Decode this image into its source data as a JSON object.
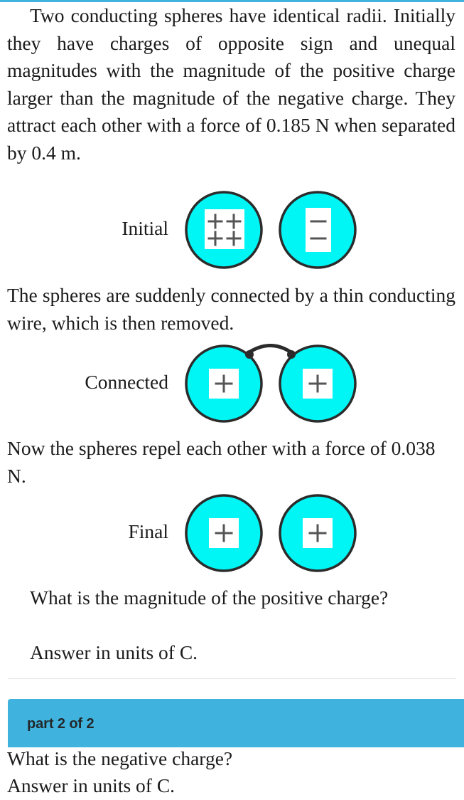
{
  "theme": {
    "sphere_fill": "#00f5f5",
    "sphere_stroke": "#2b2b2b",
    "charge_box_fill": "#ffffff",
    "charge_glyph_color": "#555555",
    "banner_color": "#3fb3de",
    "banner_text_color": "#23282b",
    "top_strip_color": "#3fb3de",
    "divider_color": "#e6e6e6",
    "body_text_color": "#1b1b1b"
  },
  "problem": {
    "intro": "Two conducting spheres have identical radii. Initially they have charges of opposite sign and unequal magnitudes with the magnitude of the positive charge larger than the magnitude of the negative charge. They attract each other with a force of 0.185 N when separated by 0.4 m.",
    "wire_text": "The spheres are suddenly connected by a thin conducting wire, which is then removed.",
    "repel_text": "Now the spheres repel each other with a force of 0.038 N.",
    "question": "What is the magnitude of the positive charge?",
    "answer_units": "Answer in units of  C.",
    "values": {
      "attractive_force": "0.185 N",
      "separation": "0.4 m",
      "repulsive_force": "0.038 N",
      "units": "C"
    }
  },
  "diagrams": [
    {
      "id": "initial",
      "label": "Initial",
      "left_sphere": {
        "charge_sign": "+",
        "charge_count": 4,
        "glyph_layout": "2x2",
        "box_shape": "square"
      },
      "right_sphere": {
        "charge_sign": "−",
        "charge_count": 2,
        "glyph_layout": "1x2",
        "box_shape": "tall"
      },
      "wire": false
    },
    {
      "id": "connected",
      "label": "Connected",
      "left_sphere": {
        "charge_sign": "+",
        "charge_count": 1,
        "glyph_layout": "1x1",
        "box_shape": "square"
      },
      "right_sphere": {
        "charge_sign": "+",
        "charge_count": 1,
        "glyph_layout": "1x1",
        "box_shape": "square"
      },
      "wire": true
    },
    {
      "id": "final",
      "label": "Final",
      "left_sphere": {
        "charge_sign": "+",
        "charge_count": 1,
        "glyph_layout": "1x1",
        "box_shape": "square"
      },
      "right_sphere": {
        "charge_sign": "+",
        "charge_count": 1,
        "glyph_layout": "1x1",
        "box_shape": "square"
      },
      "wire": false
    }
  ],
  "part_two": {
    "banner_label": "part 2 of 2",
    "question": "What is the negative charge?",
    "answer_units": "Answer in units of  C."
  }
}
